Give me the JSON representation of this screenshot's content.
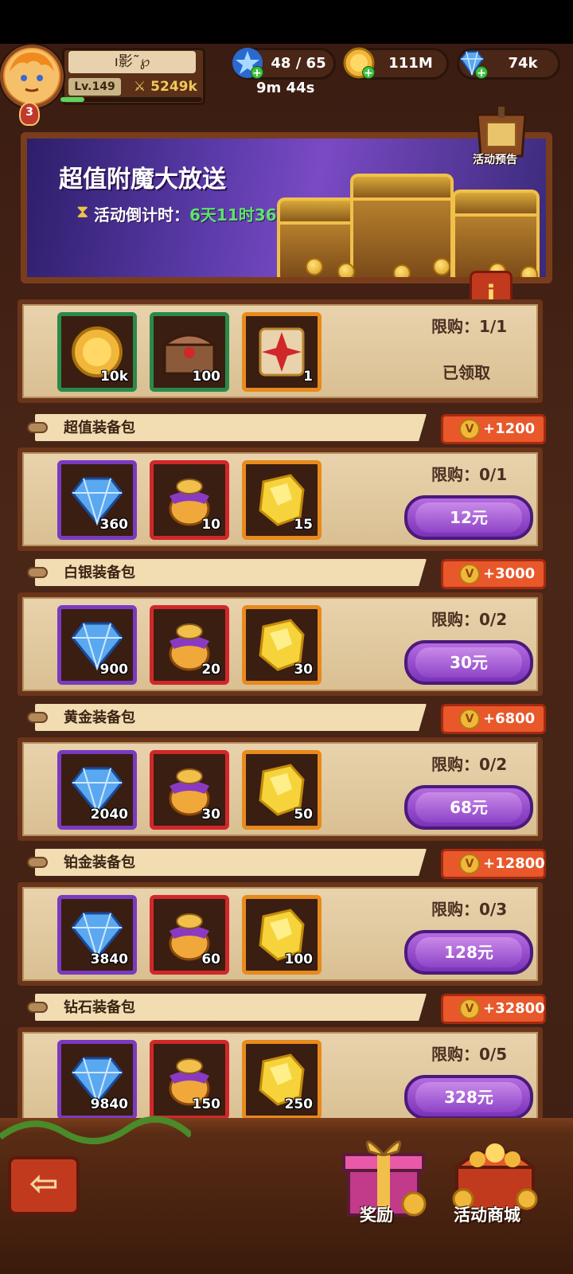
{
  "player": {
    "name": "ı影˜℘",
    "level": "Lv.149",
    "power": "5249k",
    "vip": "3"
  },
  "resources": {
    "stamina": "48 / 65",
    "stamina_timer": "9m 44s",
    "gold": "111M",
    "gems": "74k"
  },
  "banner": {
    "title": "超值附魔大放送",
    "countdown_label": "活动倒计时：",
    "countdown_value": "6天11时36分",
    "preview_label": "活动预告"
  },
  "free_pack": {
    "items": [
      {
        "icon": "gold-coin-icon",
        "qty": "10k"
      },
      {
        "icon": "chest-icon",
        "qty": "100"
      },
      {
        "icon": "enchant-scroll-icon",
        "qty": "1"
      }
    ],
    "limit": "限购：1/1",
    "status": "已领取"
  },
  "packs": [
    {
      "title": "超值装备包",
      "vip_points": "+1200",
      "limit": "限购：0/1",
      "price": "12元",
      "items": [
        {
          "icon": "gem-icon",
          "qty": "360"
        },
        {
          "icon": "loot-bag-icon",
          "qty": "10"
        },
        {
          "icon": "gold-ore-icon",
          "qty": "15"
        }
      ]
    },
    {
      "title": "白银装备包",
      "vip_points": "+3000",
      "limit": "限购：0/2",
      "price": "30元",
      "items": [
        {
          "icon": "gem-icon",
          "qty": "900"
        },
        {
          "icon": "loot-bag-icon",
          "qty": "20"
        },
        {
          "icon": "gold-ore-icon",
          "qty": "30"
        }
      ]
    },
    {
      "title": "黄金装备包",
      "vip_points": "+6800",
      "limit": "限购：0/2",
      "price": "68元",
      "items": [
        {
          "icon": "gem-icon",
          "qty": "2040"
        },
        {
          "icon": "loot-bag-icon",
          "qty": "30"
        },
        {
          "icon": "gold-ore-icon",
          "qty": "50"
        }
      ]
    },
    {
      "title": "铂金装备包",
      "vip_points": "+12800",
      "limit": "限购：0/3",
      "price": "128元",
      "items": [
        {
          "icon": "gem-icon",
          "qty": "3840"
        },
        {
          "icon": "loot-bag-icon",
          "qty": "60"
        },
        {
          "icon": "gold-ore-icon",
          "qty": "100"
        }
      ]
    },
    {
      "title": "钻石装备包",
      "vip_points": "+32800",
      "limit": "限购：0/5",
      "price": "328元",
      "items": [
        {
          "icon": "gem-icon",
          "qty": "9840"
        },
        {
          "icon": "loot-bag-icon",
          "qty": "150"
        },
        {
          "icon": "gold-ore-icon",
          "qty": "250"
        }
      ]
    }
  ],
  "bottom": {
    "gift_label": "奖励",
    "shop_label": "活动商城",
    "back_icon": "back-arrow-icon"
  },
  "colors": {
    "countdown_green": "#5fe36a",
    "vip_badge_orange": "#e8582a",
    "buy_button_purple": "#8e44c8"
  }
}
